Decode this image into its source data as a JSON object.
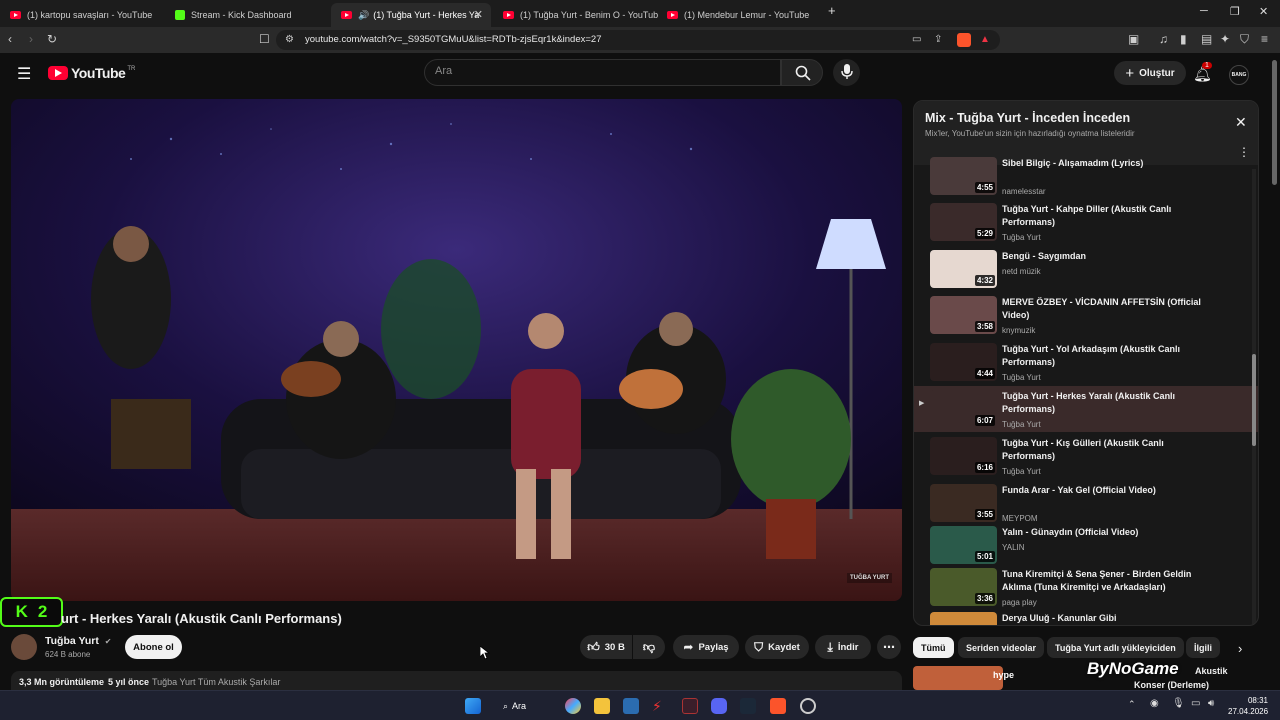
{
  "browser": {
    "tabs": [
      {
        "title": "(1) kartopu savaşları - YouTube",
        "icon": "youtube-icon"
      },
      {
        "title": "Stream - Kick Dashboard",
        "icon": "kick-icon"
      },
      {
        "title": "(1) Tuğba Yurt - Herkes Yaralı",
        "icon": "youtube-icon"
      },
      {
        "title": "(1) Tuğba Yurt - Benim O - YouTube",
        "icon": "youtube-icon"
      },
      {
        "title": "(1) Mendebur Lemur - YouTube",
        "icon": "youtube-icon"
      }
    ],
    "new_tab": "+",
    "url": "youtube.com/watch?v=_S9350TGMuU&list=RDTb-zjsEqr1k&index=27"
  },
  "header": {
    "logo": "YouTube",
    "logo_sup": "TR",
    "search_placeholder": "Ara",
    "create_label": "Oluştur",
    "notification_count": "1",
    "avatar_text": "BANG"
  },
  "video": {
    "title": "urt - Herkes Yaralı (Akustik Canlı Performans)",
    "watermark": "TUĞBA YURT",
    "overlay_badge": "2",
    "overlay_logo": "K",
    "channel": "Tuğba Yurt",
    "subscribers": "624 B abone",
    "subscribe_label": "Abone ol",
    "likes": "30 B",
    "share_label": "Paylaş",
    "save_label": "Kaydet",
    "download_label": "İndir",
    "views": "3,3 Mn görüntüleme",
    "age": "5 yıl önce",
    "desc_tag": "Tuğba Yurt Tüm Akustik Şarkılar"
  },
  "playlist": {
    "title": "Mix - Tuğba Yurt - İnceden İnceden",
    "subtitle": "Mix'ler, YouTube'un sizin için hazırladığı oynatma listeleridir",
    "items": [
      {
        "title": "Sibel Bilgiç - Alışamadım (Lyrics)",
        "channel": "namelesstar",
        "duration": "4:55"
      },
      {
        "title": "Tuğba Yurt - Kahpe Diller (Akustik Canlı Performans)",
        "channel": "Tuğba Yurt",
        "duration": "5:29"
      },
      {
        "title": "Bengü - Saygımdan",
        "channel": "netd müzik",
        "duration": "4:32"
      },
      {
        "title": "MERVE ÖZBEY - VİCDANIN AFFETSİN (Official Video)",
        "channel": "knymuzik",
        "duration": "3:58"
      },
      {
        "title": "Tuğba Yurt - Yol Arkadaşım (Akustik Canlı Performans)",
        "channel": "Tuğba Yurt",
        "duration": "4:44"
      },
      {
        "title": "Tuğba Yurt - Herkes Yaralı (Akustik Canlı Performans)",
        "channel": "Tuğba Yurt",
        "duration": "6:07"
      },
      {
        "title": "Tuğba Yurt - Kış Gülleri (Akustik Canlı Performans)",
        "channel": "Tuğba Yurt",
        "duration": "6:16"
      },
      {
        "title": "Funda Arar - Yak Gel (Official Video)",
        "channel": "MEYPOM",
        "duration": "3:55"
      },
      {
        "title": "Yalın - Günaydın (Official Video)",
        "channel": "YALIN",
        "duration": "5:01"
      },
      {
        "title": "Tuna Kiremitçi & Sena Şener - Birden Geldin Aklıma (Tuna Kiremitçi ve Arkadaşları)",
        "channel": "paga play",
        "duration": "3:36"
      },
      {
        "title": "Derya Uluğ - Kanunlar Gibi",
        "channel": "",
        "duration": ""
      }
    ]
  },
  "chips": [
    "Tümü",
    "Seriden videolar",
    "Tuğba Yurt adlı yükleyiciden",
    "İlgili"
  ],
  "rec_partial": {
    "title": "Akustik",
    "title2": "Konser (Derleme)",
    "brand": "ByNoGame",
    "hype": "hype"
  },
  "taskbar": {
    "search": "Ara",
    "time": "08:31",
    "date": "27.04.2026"
  }
}
